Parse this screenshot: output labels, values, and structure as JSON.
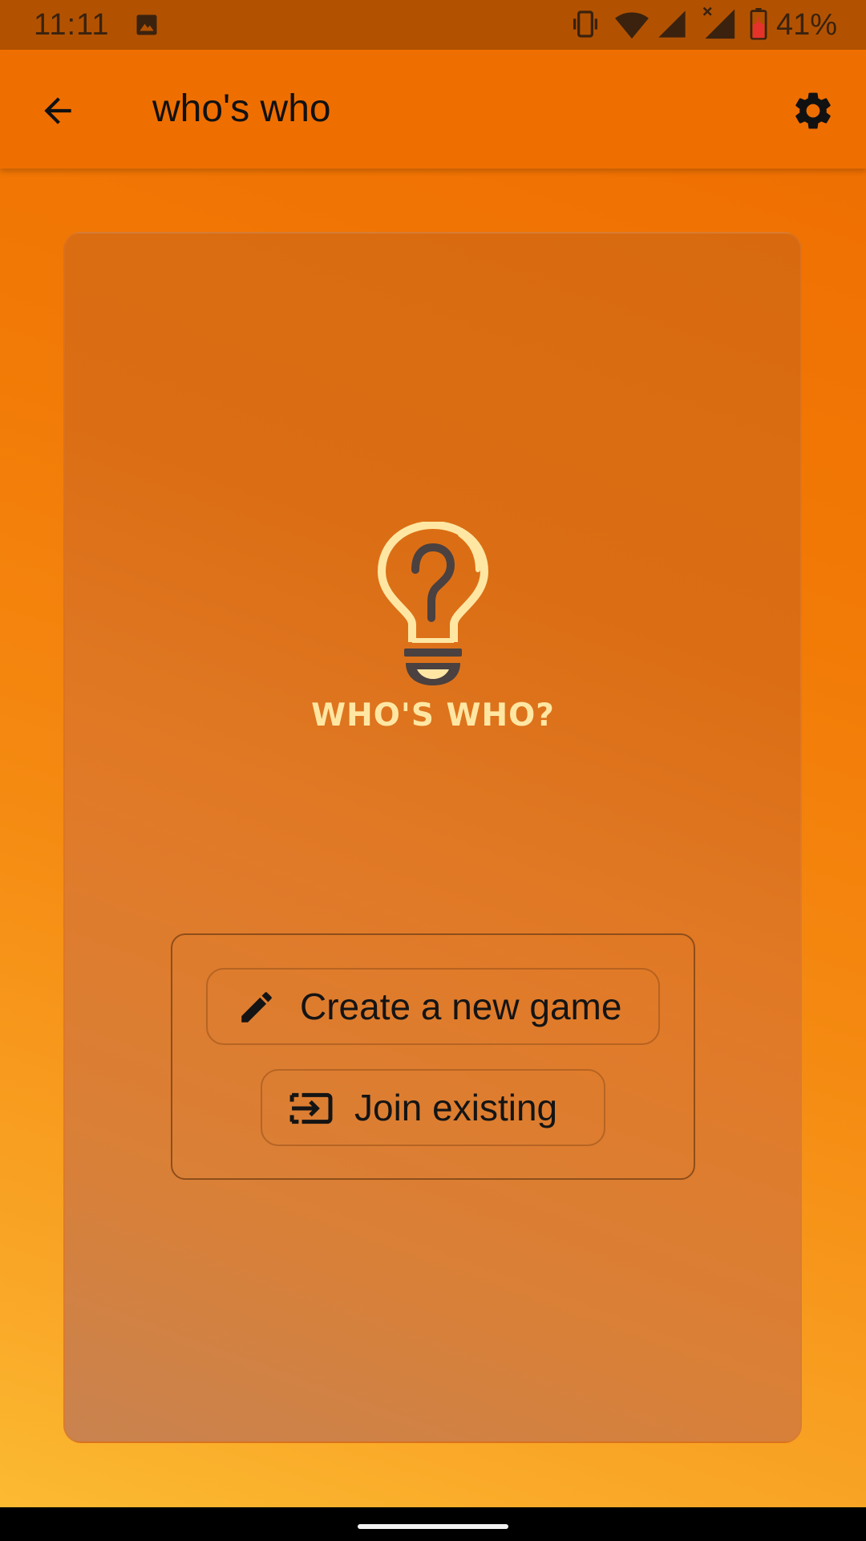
{
  "status_bar": {
    "time": "11:11",
    "battery": "41%",
    "icons": [
      "image-icon",
      "vibrate-icon",
      "wifi-icon",
      "signal-icon",
      "signal-no-data-icon",
      "battery-charging-icon"
    ]
  },
  "app_bar": {
    "title": "who's who",
    "back_icon": "arrow-back-icon",
    "settings_icon": "gear-icon"
  },
  "logo": {
    "text": "WHO'S WHO?",
    "icon": "lightbulb-question-icon"
  },
  "actions": {
    "create_label": "Create a new game",
    "create_icon": "pencil-icon",
    "join_label": "Join existing",
    "join_icon": "login-icon"
  },
  "colors": {
    "app_bar": "#ef6e00",
    "status_bar": "#b25200",
    "logo_text": "#ffe7a3",
    "logo_dark": "#4a4140"
  }
}
